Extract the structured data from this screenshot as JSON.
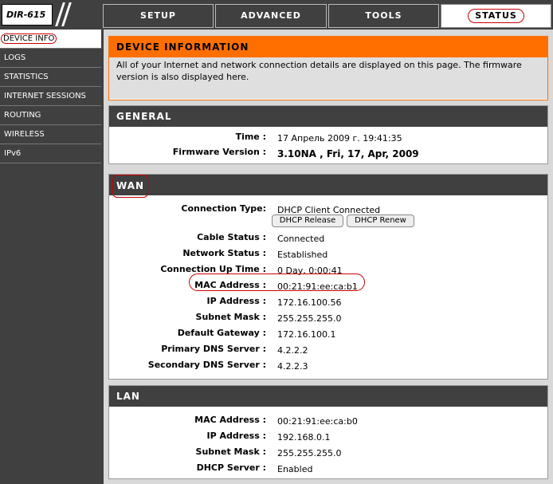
{
  "header": {
    "model": "DIR-615",
    "tabs": [
      {
        "label": "SETUP"
      },
      {
        "label": "ADVANCED"
      },
      {
        "label": "TOOLS"
      },
      {
        "label": "STATUS"
      }
    ]
  },
  "sidebar": {
    "items": [
      {
        "label": "DEVICE INFO"
      },
      {
        "label": "LOGS"
      },
      {
        "label": "STATISTICS"
      },
      {
        "label": "INTERNET SESSIONS"
      },
      {
        "label": "ROUTING"
      },
      {
        "label": "WIRELESS"
      },
      {
        "label": "IPv6"
      }
    ]
  },
  "intro": {
    "title": "DEVICE INFORMATION",
    "text": "All of your Internet and network connection details are displayed on this page. The firmware version is also displayed here."
  },
  "general": {
    "title": "GENERAL",
    "time_label": "Time :",
    "time_value": "17 Апрель 2009 г. 19:41:35",
    "firmware_label": "Firmware Version :",
    "firmware_value": "3.10NA , Fri, 17, Apr, 2009"
  },
  "wan": {
    "title": "WAN",
    "connection_type_label": "Connection Type:",
    "connection_type_value": "DHCP Client Connected",
    "dhcp_release": "DHCP Release",
    "dhcp_renew": "DHCP Renew",
    "rows": [
      {
        "label": "Cable Status :",
        "value": "Connected"
      },
      {
        "label": "Network Status :",
        "value": "Established"
      },
      {
        "label": "Connection Up Time :",
        "value": "0 Day, 0:00:41"
      },
      {
        "label": "MAC Address :",
        "value": "00:21:91:ee:ca:b1"
      },
      {
        "label": "IP Address :",
        "value": "172.16.100.56"
      },
      {
        "label": "Subnet Mask :",
        "value": "255.255.255.0"
      },
      {
        "label": "Default Gateway :",
        "value": "172.16.100.1"
      },
      {
        "label": "Primary DNS Server :",
        "value": "4.2.2.2"
      },
      {
        "label": "Secondary DNS Server :",
        "value": "4.2.2.3"
      }
    ]
  },
  "lan": {
    "title": "LAN",
    "rows": [
      {
        "label": "MAC Address :",
        "value": "00:21:91:ee:ca:b0"
      },
      {
        "label": "IP Address :",
        "value": "192.168.0.1"
      },
      {
        "label": "Subnet Mask :",
        "value": "255.255.255.0"
      },
      {
        "label": "DHCP Server :",
        "value": "Enabled"
      }
    ]
  }
}
